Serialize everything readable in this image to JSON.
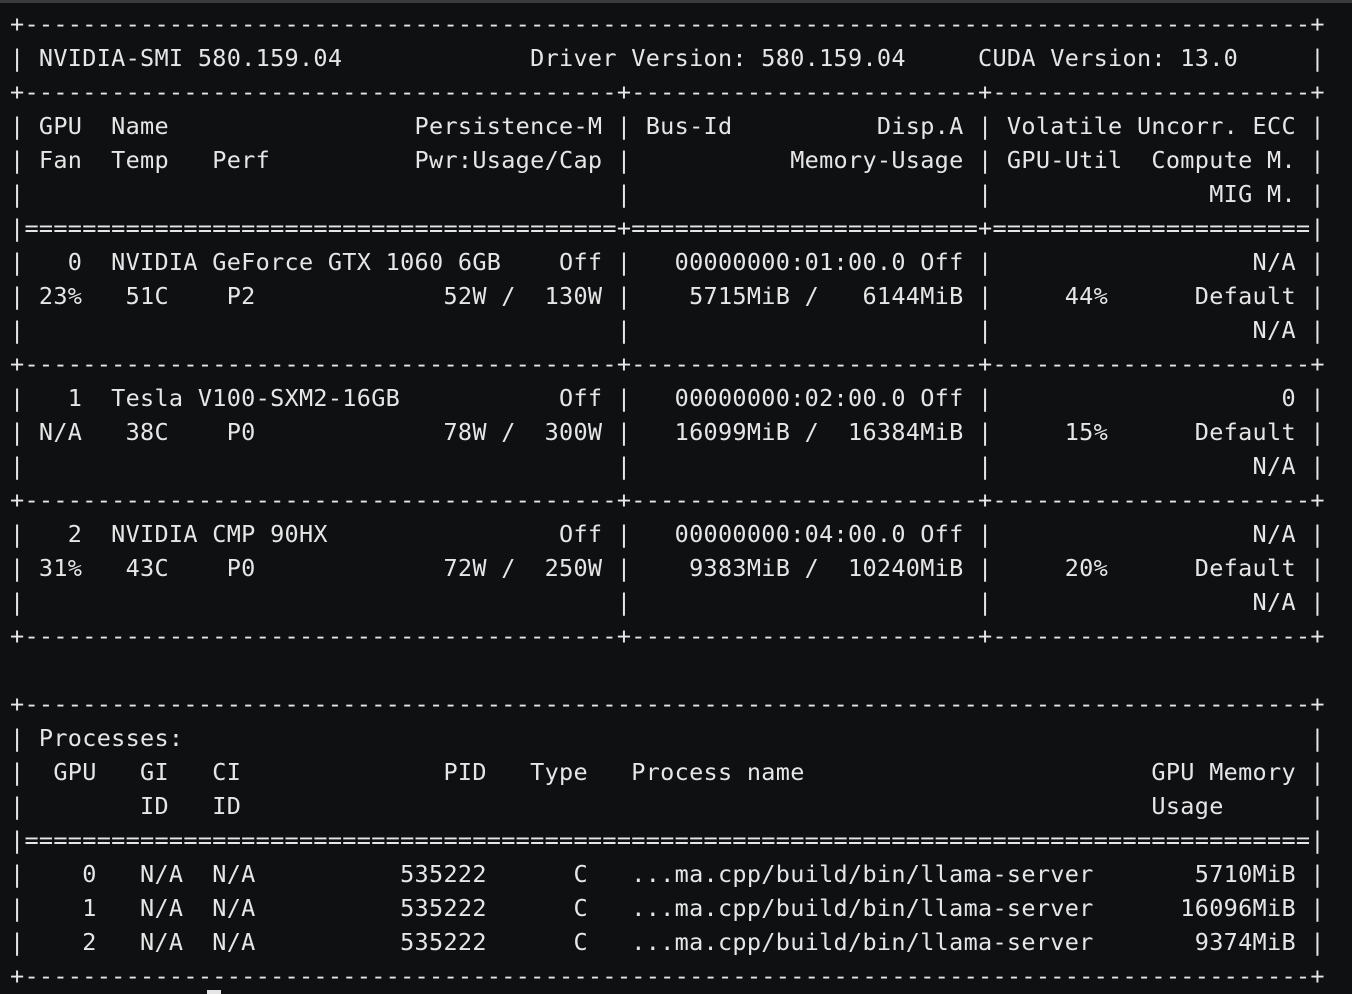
{
  "terminal": {
    "lines": [
      "+-----------------------------------------------------------------------------------------+",
      "| NVIDIA-SMI 580.159.04             Driver Version: 580.159.04     CUDA Version: 13.0     |",
      "+-----------------------------------------+------------------------+----------------------+",
      "| GPU  Name                 Persistence-M | Bus-Id          Disp.A | Volatile Uncorr. ECC |",
      "| Fan  Temp   Perf          Pwr:Usage/Cap |           Memory-Usage | GPU-Util  Compute M. |",
      "|                                         |                        |               MIG M. |",
      "|=========================================+========================+======================|",
      "|   0  NVIDIA GeForce GTX 1060 6GB    Off |   00000000:01:00.0 Off |                  N/A |",
      "| 23%   51C    P2             52W /  130W |    5715MiB /   6144MiB |     44%      Default |",
      "|                                         |                        |                  N/A |",
      "+-----------------------------------------+------------------------+----------------------+",
      "|   1  Tesla V100-SXM2-16GB           Off |   00000000:02:00.0 Off |                    0 |",
      "| N/A   38C    P0             78W /  300W |   16099MiB /  16384MiB |     15%      Default |",
      "|                                         |                        |                  N/A |",
      "+-----------------------------------------+------------------------+----------------------+",
      "|   2  NVIDIA CMP 90HX                Off |   00000000:04:00.0 Off |                  N/A |",
      "| 31%   43C    P0             72W /  250W |    9383MiB /  10240MiB |     20%      Default |",
      "|                                         |                        |                  N/A |",
      "+-----------------------------------------+------------------------+----------------------+",
      "",
      "",
      "+-----------------------------------------------------------------------------------------+",
      "| Processes:                                                                              |",
      "|  GPU   GI   CI              PID   Type   Process name                        GPU Memory |",
      "|        ID   ID                                                               Usage      |",
      "|=========================================================================================|",
      "|    0   N/A  N/A          535222      C   ...ma.cpp/build/bin/llama-server       5710MiB |",
      "|    1   N/A  N/A          535222      C   ...ma.cpp/build/bin/llama-server      16096MiB |",
      "|    2   N/A  N/A          535222      C   ...ma.cpp/build/bin/llama-server       9374MiB |",
      "+-----------------------------------------------------------------------------------------+"
    ]
  },
  "colors": {
    "background": "#0f1012",
    "text": "#e6e6e6"
  }
}
